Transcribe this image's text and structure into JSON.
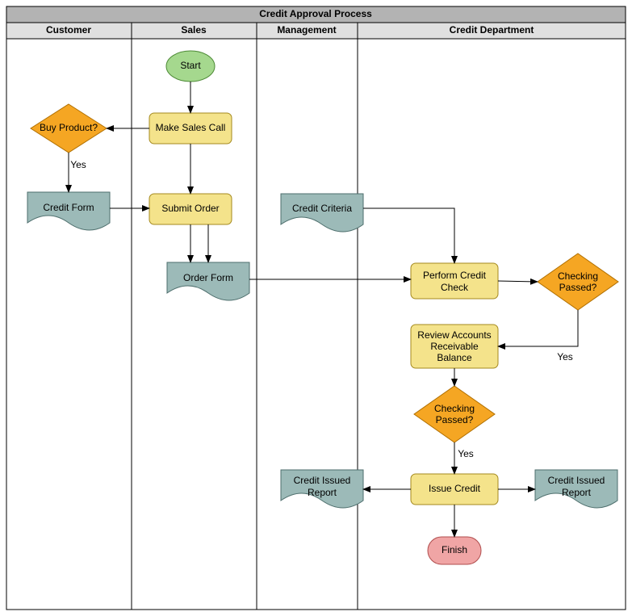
{
  "title": "Credit Approval Process",
  "lanes": {
    "customer": "Customer",
    "sales": "Sales",
    "management": "Management",
    "credit": "Credit Department"
  },
  "nodes": {
    "start": "Start",
    "makeSalesCall": "Make Sales Call",
    "buyProduct": "Buy Product?",
    "creditForm": "Credit Form",
    "submitOrder": "Submit Order",
    "orderForm": "Order Form",
    "creditCriteria": "Credit Criteria",
    "performCheckL1": "Perform Credit",
    "performCheckL2": "Check",
    "checkingPassed1": "Checking",
    "checkingPassed1b": "Passed?",
    "reviewARB1": "Review Accounts",
    "reviewARB2": "Receivable",
    "reviewARB3": "Balance",
    "checkingPassed2": "Checking",
    "checkingPassed2b": "Passed?",
    "issueCredit": "Issue Credit",
    "report1L1": "Credit Issued",
    "report1L2": "Report",
    "report2L1": "Credit Issued",
    "report2L2": "Report",
    "finish": "Finish"
  },
  "edgeLabels": {
    "yes1": "Yes",
    "yes2": "Yes",
    "yes3": "Yes"
  },
  "chart_data": {
    "type": "swimlane-flowchart",
    "title": "Credit Approval Process",
    "lanes": [
      "Customer",
      "Sales",
      "Management",
      "Credit Department"
    ],
    "nodes": [
      {
        "id": "start",
        "type": "terminator",
        "lane": "Sales",
        "label": "Start"
      },
      {
        "id": "makeSalesCall",
        "type": "process",
        "lane": "Sales",
        "label": "Make Sales Call"
      },
      {
        "id": "buyProduct",
        "type": "decision",
        "lane": "Customer",
        "label": "Buy Product?"
      },
      {
        "id": "creditForm",
        "type": "document",
        "lane": "Customer",
        "label": "Credit Form"
      },
      {
        "id": "submitOrder",
        "type": "process",
        "lane": "Sales",
        "label": "Submit Order"
      },
      {
        "id": "orderForm",
        "type": "document",
        "lane": "Sales",
        "label": "Order Form"
      },
      {
        "id": "creditCriteria",
        "type": "document",
        "lane": "Management",
        "label": "Credit Criteria"
      },
      {
        "id": "performCheck",
        "type": "process",
        "lane": "Credit Department",
        "label": "Perform Credit Check"
      },
      {
        "id": "checkingPassed1",
        "type": "decision",
        "lane": "Credit Department",
        "label": "Checking Passed?"
      },
      {
        "id": "reviewARB",
        "type": "process",
        "lane": "Credit Department",
        "label": "Review Accounts Receivable Balance"
      },
      {
        "id": "checkingPassed2",
        "type": "decision",
        "lane": "Credit Department",
        "label": "Checking Passed?"
      },
      {
        "id": "issueCredit",
        "type": "process",
        "lane": "Credit Department",
        "label": "Issue Credit"
      },
      {
        "id": "report1",
        "type": "document",
        "lane": "Management",
        "label": "Credit Issued Report"
      },
      {
        "id": "report2",
        "type": "document",
        "lane": "Credit Department",
        "label": "Credit Issued Report"
      },
      {
        "id": "finish",
        "type": "terminator",
        "lane": "Credit Department",
        "label": "Finish"
      }
    ],
    "edges": [
      {
        "from": "start",
        "to": "makeSalesCall"
      },
      {
        "from": "makeSalesCall",
        "to": "buyProduct"
      },
      {
        "from": "makeSalesCall",
        "to": "submitOrder"
      },
      {
        "from": "buyProduct",
        "to": "creditForm",
        "label": "Yes"
      },
      {
        "from": "creditForm",
        "to": "submitOrder"
      },
      {
        "from": "submitOrder",
        "to": "orderForm"
      },
      {
        "from": "orderForm",
        "to": "performCheck"
      },
      {
        "from": "creditCriteria",
        "to": "performCheck"
      },
      {
        "from": "performCheck",
        "to": "checkingPassed1"
      },
      {
        "from": "checkingPassed1",
        "to": "reviewARB",
        "label": "Yes"
      },
      {
        "from": "reviewARB",
        "to": "checkingPassed2"
      },
      {
        "from": "checkingPassed2",
        "to": "issueCredit",
        "label": "Yes"
      },
      {
        "from": "issueCredit",
        "to": "report1"
      },
      {
        "from": "issueCredit",
        "to": "report2"
      },
      {
        "from": "issueCredit",
        "to": "finish"
      }
    ]
  }
}
